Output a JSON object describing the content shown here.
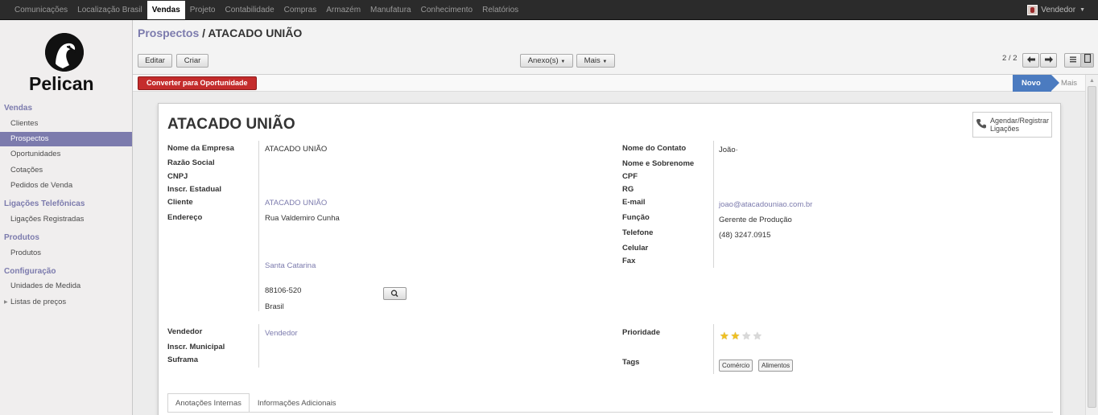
{
  "top_menu": [
    "Comunicações",
    "Localização Brasil",
    "Vendas",
    "Projeto",
    "Contabilidade",
    "Compras",
    "Armazém",
    "Manufatura",
    "Conhecimento",
    "Relatórios"
  ],
  "top_menu_active": "Vendas",
  "user": {
    "name": "Vendedor"
  },
  "logo": {
    "text": "Pelican"
  },
  "sidebar": {
    "sections": [
      {
        "title": "Vendas",
        "items": [
          "Clientes",
          "Prospectos",
          "Oportunidades",
          "Cotações",
          "Pedidos de Venda"
        ]
      },
      {
        "title": "Ligações Telefônicas",
        "items": [
          "Ligações Registradas"
        ]
      },
      {
        "title": "Produtos",
        "items": [
          "Produtos"
        ]
      },
      {
        "title": "Configuração",
        "items": [
          "Unidades de Medida",
          "Listas de preços"
        ]
      }
    ],
    "active_item": "Prospectos"
  },
  "breadcrumb": {
    "parent": "Prospectos",
    "separator": " / ",
    "current": "ATACADO UNIÃO"
  },
  "toolbar": {
    "edit_label": "Editar",
    "create_label": "Criar",
    "attachments_label": "Anexo(s)",
    "more_label": "Mais",
    "pager": "2 / 2",
    "prev_icon": "arrow-left-icon",
    "next_icon": "arrow-right-icon",
    "list_view_icon": "list-view-icon",
    "form_view_icon": "form-view-icon"
  },
  "statusbar": {
    "convert_label": "Converter para Oportunidade",
    "stage_current": "Novo",
    "stage_more": "Mais",
    "convert_color": "#c42c2c",
    "stage_color": "#4b7bc0"
  },
  "record": {
    "title": "ATACADO UNIÃO",
    "call_button": {
      "line1": "Agendar/Registrar",
      "line2": "Ligações"
    },
    "left_labels": {
      "company": "Nome da Empresa",
      "legal_name": "Razão Social",
      "cnpj": "CNPJ",
      "state_reg": "Inscr. Estadual",
      "customer": "Cliente",
      "address": "Endereço",
      "salesperson": "Vendedor",
      "municipal_reg": "Inscr. Municipal",
      "suframa": "Suframa"
    },
    "left_values": {
      "company": "ATACADO UNIÃO",
      "customer": "ATACADO UNIÃO",
      "street": "Rua Valdemiro Cunha",
      "state": "Santa Catarina",
      "zip": "88106-520",
      "country": "Brasil",
      "salesperson": "Vendedor"
    },
    "right_labels": {
      "contact": "Nome do Contato",
      "full_name": "Nome e Sobrenome",
      "cpf": "CPF",
      "rg": "RG",
      "email": "E-mail",
      "function": "Função",
      "phone": "Telefone",
      "mobile": "Celular",
      "fax": "Fax",
      "priority": "Prioridade",
      "tags": "Tags"
    },
    "right_values": {
      "contact": "João·",
      "email": "joao@atacadouniao.com.br",
      "function": "Gerente de Produção",
      "phone": "(48) 3247.0915"
    },
    "priority_stars": 2,
    "priority_max": 4,
    "tags": [
      "Comércio",
      "Alimentos"
    ]
  },
  "tabs": [
    "Anotações Internas",
    "Informações Adicionais"
  ],
  "active_tab": "Anotações Internas"
}
